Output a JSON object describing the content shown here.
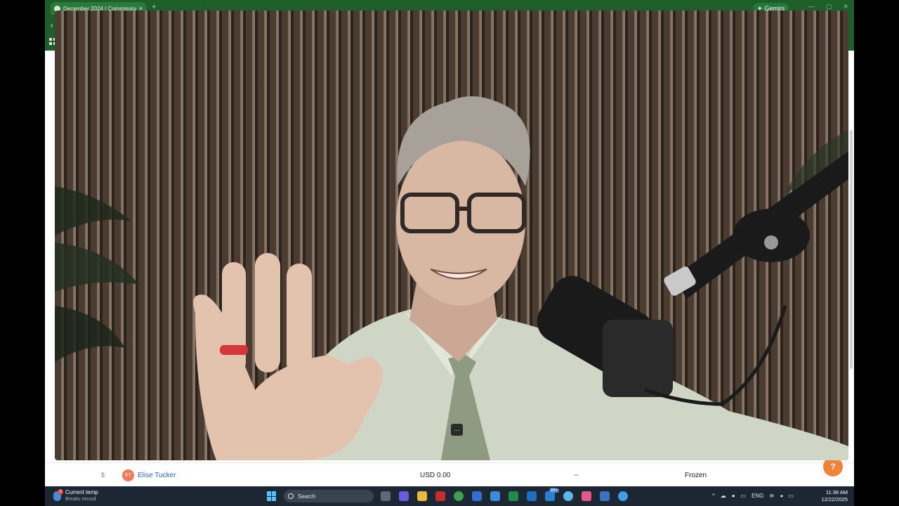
{
  "browser": {
    "tab_title": "December 2024 | Commissions",
    "tab_close": "×",
    "new_tab": "+",
    "gemini_label": "Gemini",
    "gemini_icon": "sparkle-icon",
    "window_controls": [
      "—",
      "▢",
      "✕"
    ],
    "back_icon": "‹"
  },
  "table_row": {
    "number": "5",
    "avatar_initials": "ET",
    "name": "Elise Tucker",
    "amount": "USD 0.00",
    "dash": "--",
    "status": "Frozen"
  },
  "help_button": {
    "label": "?"
  },
  "video": {
    "more_label": "···"
  },
  "taskbar": {
    "weather_title": "Current temp",
    "weather_subtitle": "Breaks record",
    "weather_badge": "2",
    "search_label": "Search",
    "language": "ENG",
    "time": "11:38 AM",
    "date": "12/22/2025",
    "badge_count": "99+"
  },
  "colors": {
    "browser_chrome": "#1d5e2a",
    "taskbar": "#1d2733",
    "accent_blue": "#4cc2ff",
    "help_orange": "#f0833a",
    "link_blue": "#2a63c9"
  }
}
